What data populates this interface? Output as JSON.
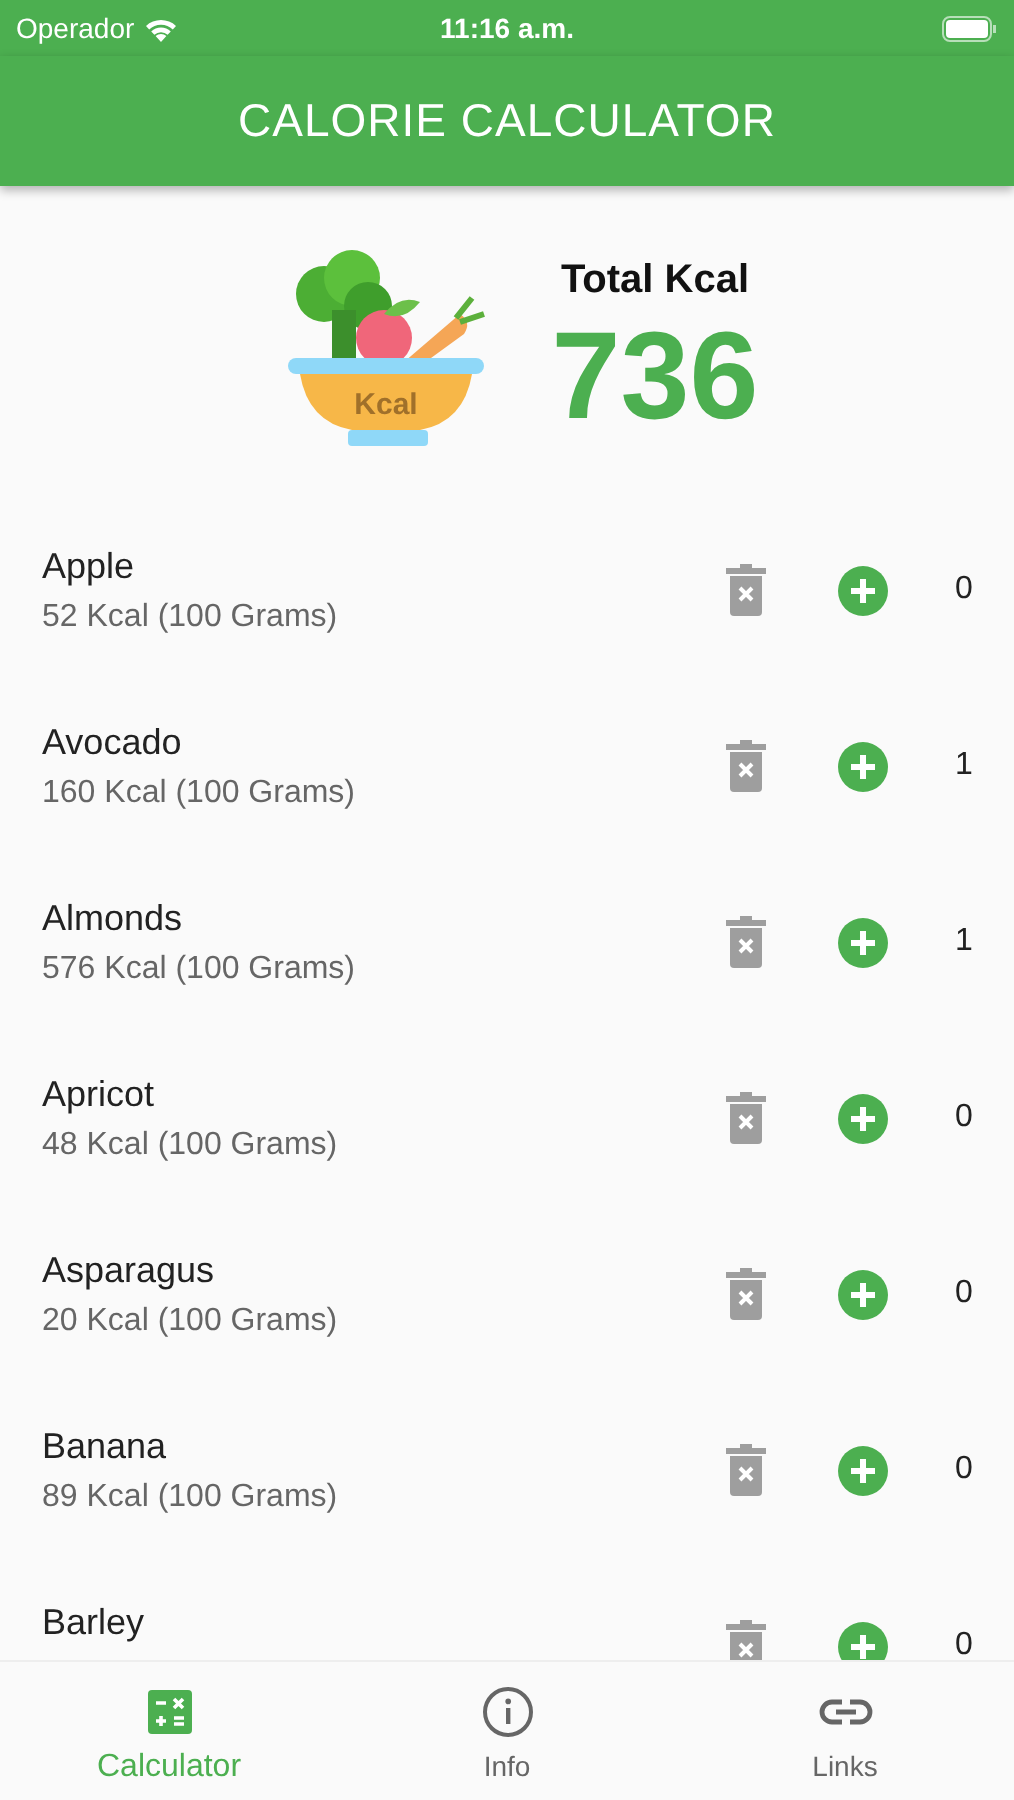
{
  "status_bar": {
    "carrier": "Operador",
    "time": "11:16 a.m."
  },
  "app_bar": {
    "title": "CALORIE CALCULATOR"
  },
  "summary": {
    "logo_label": "Kcal",
    "label": "Total Kcal",
    "total": "736"
  },
  "foods": [
    {
      "name": "Apple",
      "detail": "52 Kcal (100 Grams)",
      "count": "0"
    },
    {
      "name": "Avocado",
      "detail": "160 Kcal (100 Grams)",
      "count": "1"
    },
    {
      "name": "Almonds",
      "detail": "576 Kcal (100 Grams)",
      "count": "1"
    },
    {
      "name": "Apricot",
      "detail": "48 Kcal (100 Grams)",
      "count": "0"
    },
    {
      "name": "Asparagus",
      "detail": "20 Kcal (100 Grams)",
      "count": "0"
    },
    {
      "name": "Banana",
      "detail": "89 Kcal (100 Grams)",
      "count": "0"
    },
    {
      "name": "Barley",
      "count": "0"
    }
  ],
  "tabs": [
    {
      "kind": "calculator",
      "label": "Calculator",
      "selected": true
    },
    {
      "kind": "info",
      "label": "Info",
      "selected": false
    },
    {
      "kind": "links",
      "label": "Links",
      "selected": false
    }
  ]
}
